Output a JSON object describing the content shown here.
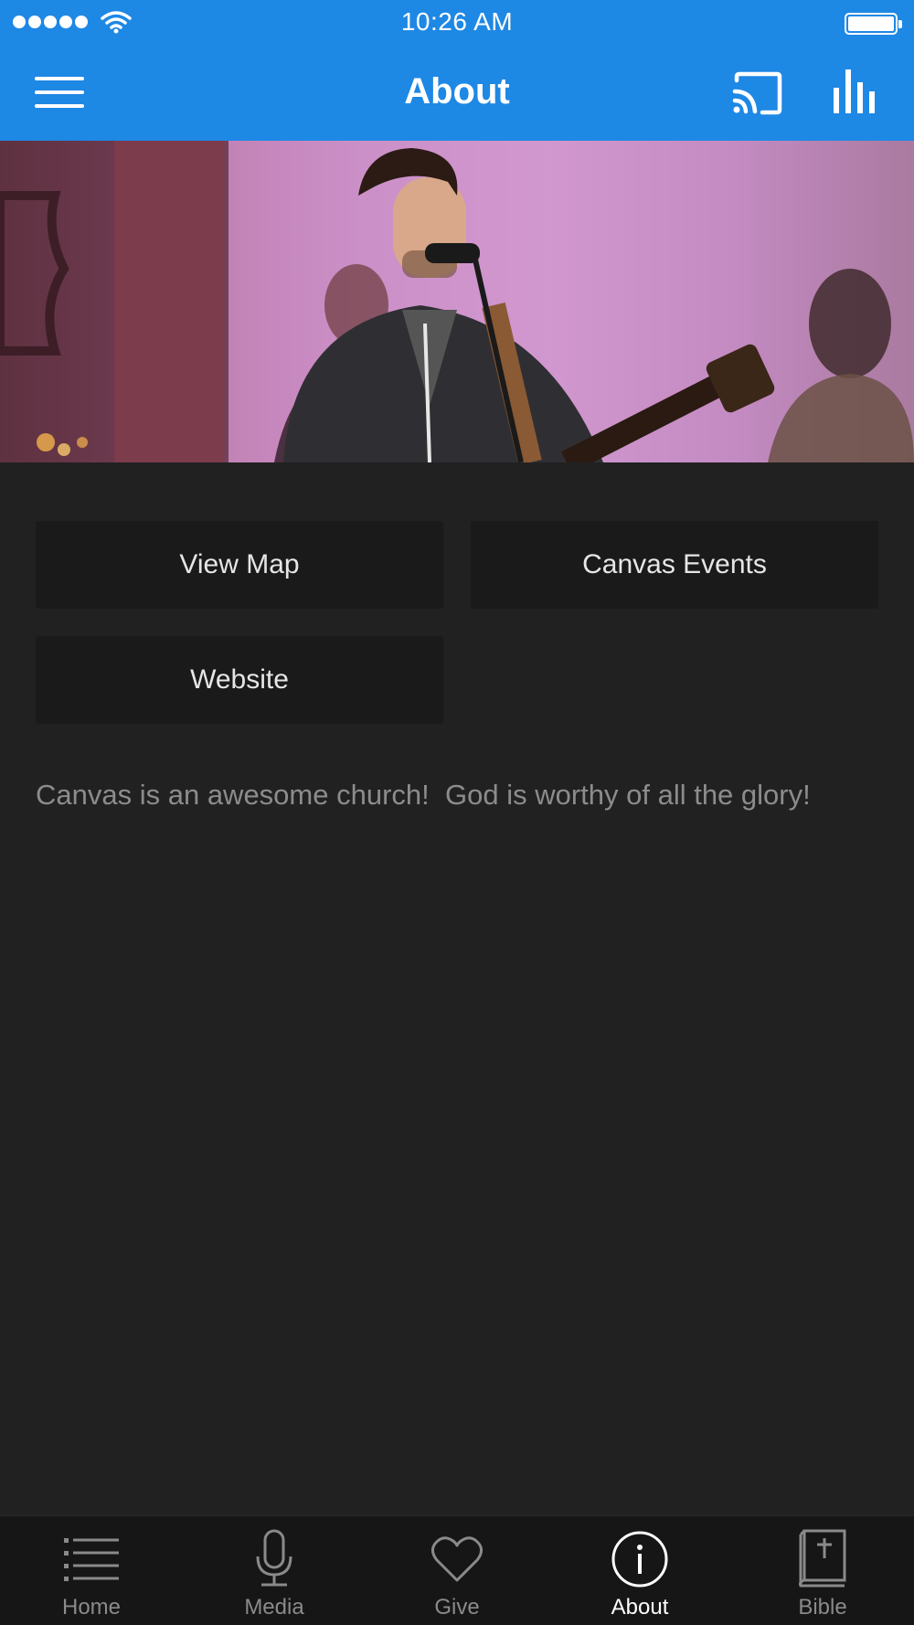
{
  "status_bar": {
    "time": "10:26 AM"
  },
  "header": {
    "title": "About"
  },
  "icons": {
    "menu": "hamburger-menu-icon",
    "cast": "cast-icon",
    "stats": "bar-chart-icon"
  },
  "hero": {
    "description": "Worship leader singing into a microphone with a guitar"
  },
  "buttons": {
    "view_map": "View Map",
    "canvas_events": "Canvas Events",
    "website": "Website"
  },
  "about": {
    "text": "Canvas is an awesome church!  God is worthy of all the glory!"
  },
  "tabs": [
    {
      "label": "Home",
      "icon": "list-icon",
      "active": false
    },
    {
      "label": "Media",
      "icon": "microphone-icon",
      "active": false
    },
    {
      "label": "Give",
      "icon": "heart-icon",
      "active": false
    },
    {
      "label": "About",
      "icon": "info-icon",
      "active": true
    },
    {
      "label": "Bible",
      "icon": "bible-icon",
      "active": false
    }
  ],
  "colors": {
    "accent": "#1e88e5",
    "background": "#212121",
    "tabbar": "#161616"
  }
}
